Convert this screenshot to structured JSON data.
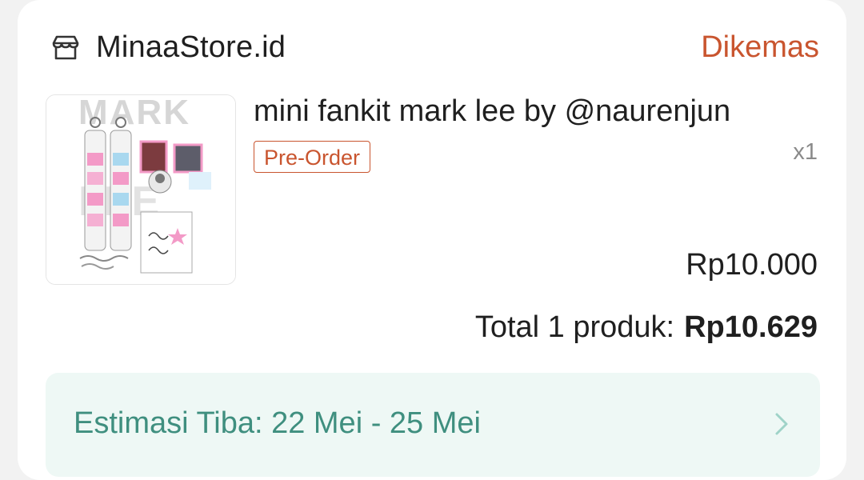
{
  "store": {
    "name": "MinaaStore.id",
    "icon": "store-icon",
    "status": "Dikemas",
    "status_color": "#c9552f"
  },
  "product": {
    "title": "mini fankit mark lee by @naurenjun",
    "badge": "Pre-Order",
    "quantity": "x1",
    "price": "Rp10.000",
    "image_logo_text": "MARK"
  },
  "summary": {
    "total_label": "Total 1 produk:",
    "total_amount": "Rp10.629"
  },
  "estimate": {
    "text": "Estimasi Tiba: 22 Mei - 25 Mei",
    "icon": "chevron-right-icon",
    "color": "#3f8f7f"
  }
}
